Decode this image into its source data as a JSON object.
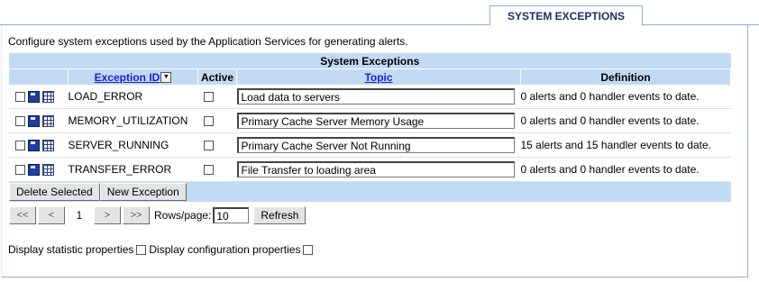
{
  "tab": {
    "label": "SYSTEM EXCEPTIONS"
  },
  "description": "Configure system exceptions used by the Application Services for generating alerts.",
  "table": {
    "caption": "System Exceptions",
    "headers": {
      "exception_id": "Exception ID",
      "active": "Active",
      "topic": "Topic",
      "definition": "Definition"
    },
    "rows": [
      {
        "id": "LOAD_ERROR",
        "topic": "Load data to servers",
        "definition": "0 alerts and 0 handler events to date."
      },
      {
        "id": "MEMORY_UTILIZATION",
        "topic": "Primary Cache Server Memory Usage",
        "definition": "0 alerts and 0 handler events to date."
      },
      {
        "id": "SERVER_RUNNING",
        "topic": "Primary Cache Server Not Running",
        "definition": "15 alerts and 15 handler events to date."
      },
      {
        "id": "TRANSFER_ERROR",
        "topic": "File Transfer to loading area",
        "definition": "0 alerts and 0 handler events to date."
      }
    ],
    "buttons": {
      "delete_selected": "Delete Selected",
      "new_exception": "New Exception"
    }
  },
  "pager": {
    "first": "<<",
    "prev": "<",
    "page": "1",
    "next": ">",
    "last": ">>",
    "rows_label": "Rows/page:",
    "rows_value": "10",
    "refresh": "Refresh"
  },
  "options": {
    "statistic": "Display statistic properties",
    "configuration": "Display configuration properties"
  }
}
